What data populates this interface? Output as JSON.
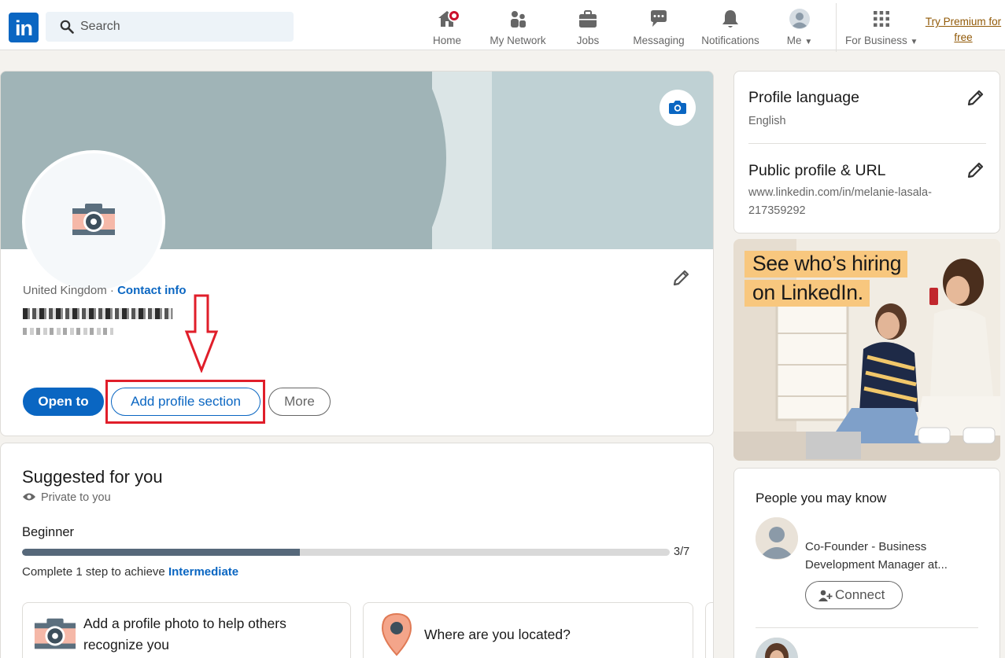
{
  "nav": {
    "logo": "in",
    "search_placeholder": "Search",
    "items": [
      {
        "label": "Home"
      },
      {
        "label": "My Network"
      },
      {
        "label": "Jobs"
      },
      {
        "label": "Messaging"
      },
      {
        "label": "Notifications"
      },
      {
        "label": "Me"
      },
      {
        "label": "For Business"
      }
    ],
    "premium_line1": "Try Premium for",
    "premium_line2": "free"
  },
  "profile": {
    "location": "United Kingdom",
    "separator": " · ",
    "contact_info": "Contact info",
    "buttons": {
      "open_to": "Open to",
      "add_section": "Add profile section",
      "more": "More"
    }
  },
  "suggested": {
    "title": "Suggested for you",
    "private": "Private to you",
    "level": "Beginner",
    "progress": {
      "current": 3,
      "total": 7,
      "label": "3/7"
    },
    "complete_prefix": "Complete 1 step to achieve ",
    "next_level": "Intermediate",
    "cards": [
      {
        "line1": "Add a profile photo to help others",
        "line2": "recognize you"
      },
      {
        "line1": "Where are you located?"
      }
    ]
  },
  "sidebar": {
    "language_title": "Profile language",
    "language_value": "English",
    "url_title": "Public profile & URL",
    "url_line1": "www.linkedin.com/in/melanie-lasala-",
    "url_line2": "217359292"
  },
  "ad": {
    "line1": "See who’s hiring",
    "line2": "on LinkedIn."
  },
  "pymk": {
    "title": "People you may know",
    "person_desc_line1": "Co-Founder - Business",
    "person_desc_line2": "Development Manager at...",
    "connect_label": "Connect"
  },
  "colors": {
    "brand": "#0a66c2",
    "premium": "#915907",
    "annotation": "#e01e2a"
  }
}
